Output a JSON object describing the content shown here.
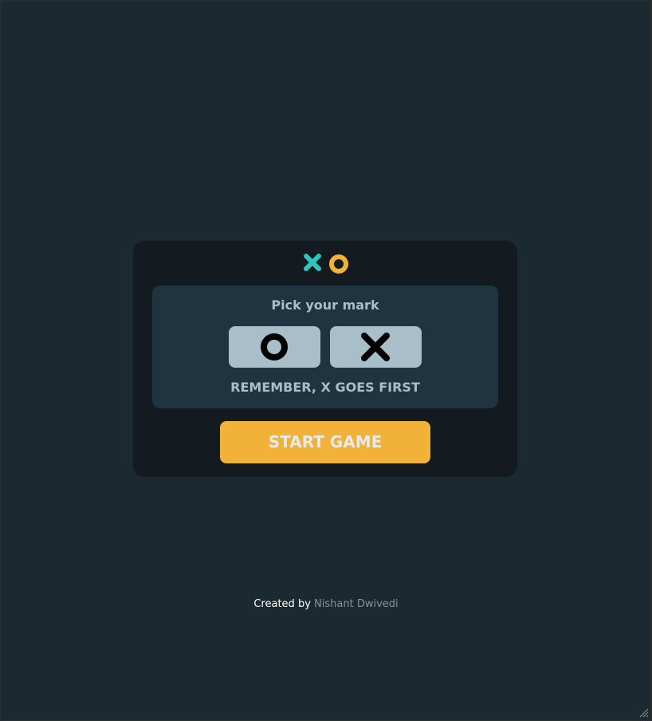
{
  "logo": {
    "x_icon": "x-mark-icon",
    "o_icon": "o-mark-icon",
    "x_color": "#31c4be",
    "o_color": "#f1b237"
  },
  "picker": {
    "title": "Pick your mark",
    "options": [
      {
        "icon": "o-mark-icon",
        "color": "#000000",
        "background": "#a8bec9"
      },
      {
        "icon": "x-mark-icon",
        "color": "#000000",
        "background": "#a8bec9"
      }
    ],
    "note": "REMEMBER, X GOES FIRST"
  },
  "start_button": {
    "label": "START GAME",
    "background": "#f1b237"
  },
  "footer": {
    "prefix": "Created by",
    "author": "Nishant Dwivedi"
  },
  "colors": {
    "page_background": "#1b2930",
    "card_background": "#131b21",
    "panel_background": "#1f3440"
  }
}
